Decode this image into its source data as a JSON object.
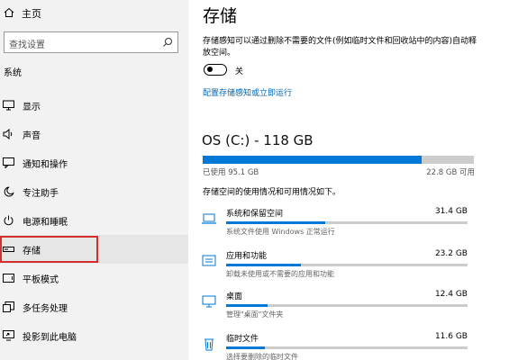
{
  "sidebar": {
    "home_label": "主页",
    "search_placeholder": "查找设置",
    "section_title": "系统",
    "items": [
      {
        "label": "显示",
        "icon": "monitor-icon"
      },
      {
        "label": "声音",
        "icon": "speaker-icon"
      },
      {
        "label": "通知和操作",
        "icon": "notification-icon"
      },
      {
        "label": "专注助手",
        "icon": "moon-icon"
      },
      {
        "label": "电源和睡眠",
        "icon": "power-icon"
      },
      {
        "label": "存储",
        "icon": "storage-icon"
      },
      {
        "label": "平板模式",
        "icon": "tablet-icon"
      },
      {
        "label": "多任务处理",
        "icon": "multitask-icon"
      },
      {
        "label": "投影到此电脑",
        "icon": "project-icon"
      }
    ],
    "selected_index": 5
  },
  "main": {
    "title": "存储",
    "description": "存储感知可以通过删除不需要的文件(例如临时文件和回收站中的内容)自动释放空间。",
    "toggle": {
      "state": "off",
      "label": "关"
    },
    "config_link": "配置存储感知或立即运行",
    "drive": {
      "title": "OS (C:) - 118 GB",
      "used_label": "已使用 95.1 GB",
      "free_label": "22.8 GB 可用",
      "used_fraction": 0.806
    },
    "usage_desc": "存储空间的使用情况和可用情况如下。",
    "categories": [
      {
        "name": "系统和保留空间",
        "size": "31.4 GB",
        "sub": "系统文件使用 Windows 正常运行",
        "fraction": 0.41,
        "icon": "laptop-icon"
      },
      {
        "name": "应用和功能",
        "size": "23.2 GB",
        "sub": "卸载未使用或不需要的应用和功能",
        "fraction": 0.31,
        "icon": "apps-icon"
      },
      {
        "name": "桌面",
        "size": "12.4 GB",
        "sub": "管理\"桌面\"文件夹",
        "fraction": 0.17,
        "icon": "desktop-icon"
      },
      {
        "name": "临时文件",
        "size": "11.6 GB",
        "sub": "选择要删除的临时文件",
        "fraction": 0.16,
        "icon": "trash-icon"
      }
    ]
  },
  "colors": {
    "accent": "#0078d7",
    "link": "#0067b8",
    "highlight": "#d32f2f"
  }
}
